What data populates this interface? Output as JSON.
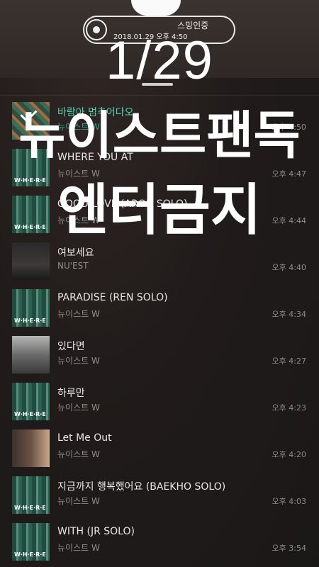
{
  "header": {
    "pill_title": "스밍인증",
    "pill_time": "2018.01.29 오후 4:50",
    "date_big": "1/29"
  },
  "overlay": {
    "title": "뉴이스트팬독",
    "subtitle": "엔터금지"
  },
  "songs": [
    {
      "title": "바람아 멈추어다오",
      "artist": "뉴이스트 W",
      "time": "오후 4:50",
      "art": "first",
      "playing": true
    },
    {
      "title": "WHERE YOU AT",
      "artist": "뉴이스트 W",
      "time": "오후 4:47",
      "art": "whe"
    },
    {
      "title": "GOOD LOVE (ARON SOLO)",
      "artist": "뉴이스트 W",
      "time": "오후 4:44",
      "art": "whe"
    },
    {
      "title": "여보세요",
      "artist": "NU'EST",
      "time": "오후 4:40",
      "art": "band"
    },
    {
      "title": "PARADISE (REN SOLO)",
      "artist": "뉴이스트 W",
      "time": "오후 4:34",
      "art": "whe"
    },
    {
      "title": "있다면",
      "artist": "뉴이스트 W",
      "time": "오후 4:27",
      "art": "bw"
    },
    {
      "title": "하루만",
      "artist": "뉴이스트 W",
      "time": "오후 4:23",
      "art": "whe"
    },
    {
      "title": "Let Me Out",
      "artist": "뉴이스트 W",
      "time": "오후 4:20",
      "art": "portrait"
    },
    {
      "title": "지금까지 행복했어요 (BAEKHO SOLO)",
      "artist": "뉴이스트 W",
      "time": "오후 4:03",
      "art": "whe"
    },
    {
      "title": "WITH (JR SOLO)",
      "artist": "뉴이스트 W",
      "time": "오후 3:54",
      "art": "whe"
    }
  ],
  "colors": {
    "accent": "#55d0b3",
    "background": "#1c1a1a"
  }
}
